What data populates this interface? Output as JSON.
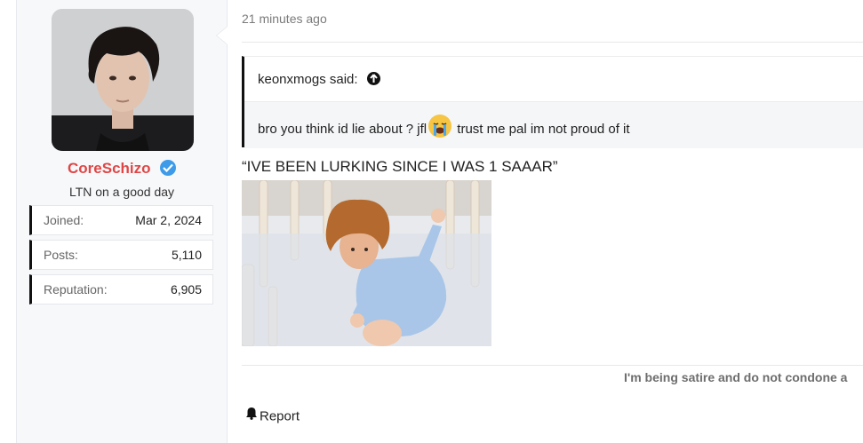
{
  "user": {
    "name": "CoreSchizo",
    "title": "LTN on a good day",
    "avatar_icon": "user-avatar-photo",
    "stats": [
      {
        "label": "Joined:",
        "value": "Mar 2, 2024"
      },
      {
        "label": "Posts:",
        "value": "5,110"
      },
      {
        "label": "Reputation:",
        "value": "6,905"
      }
    ]
  },
  "post": {
    "time": "21 minutes ago",
    "quote": {
      "author": "keonxmogs said:",
      "text_before": "bro you think id lie about ? jfl",
      "emoji": "loudly-crying-face-emoji",
      "text_after": "trust me pal im not proud of it"
    },
    "text": "“IVE BEEN LURKING SINCE I WAS 1 SAAAR”",
    "image_desc_icon": "baby-doll-in-crib-image",
    "signature": "I'm being satire and do not condone a",
    "report_label": "Report"
  },
  "colors": {
    "username": "#e04646",
    "verified": "#3d9be9",
    "accent_border": "#111111"
  }
}
